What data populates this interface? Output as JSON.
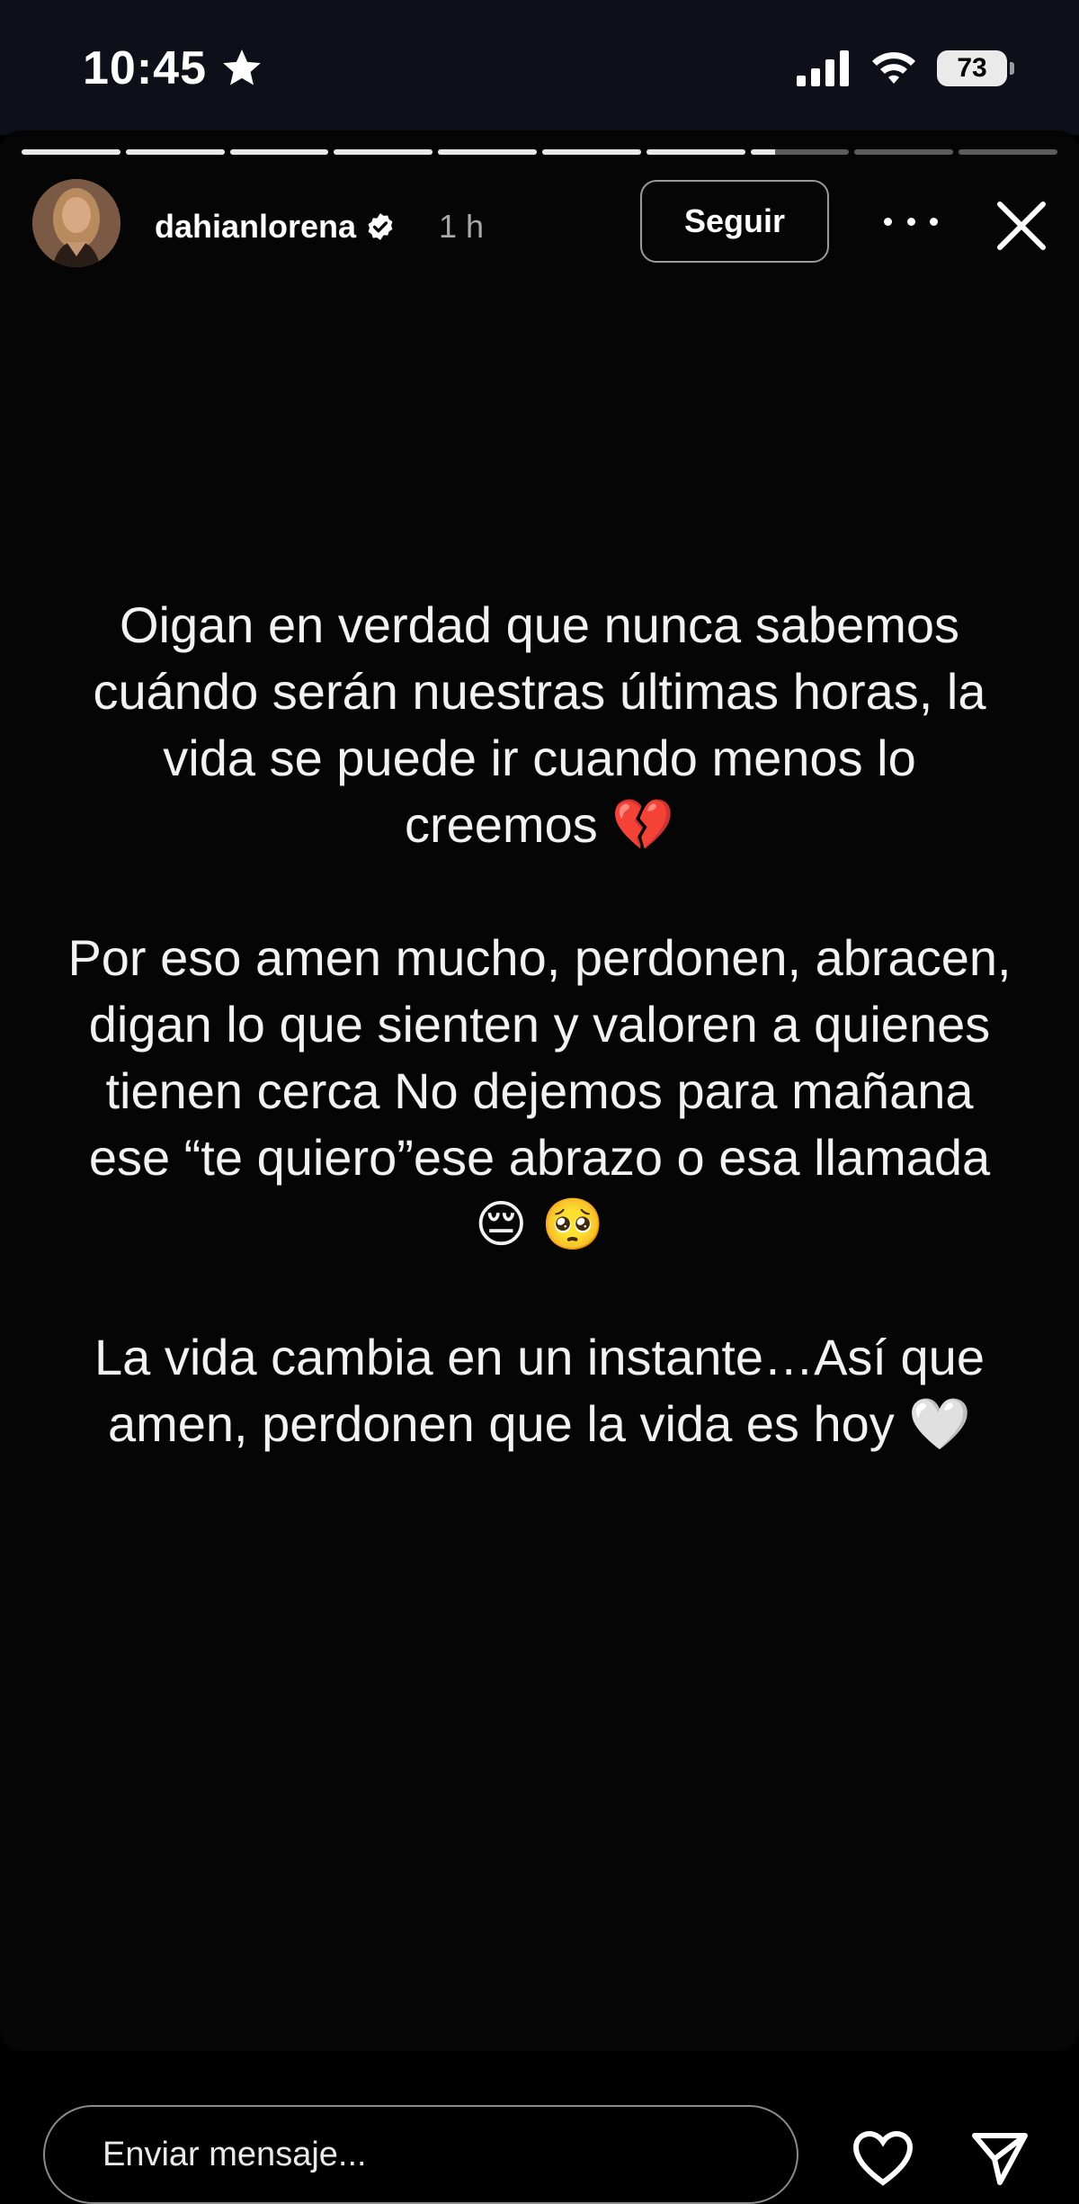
{
  "status_bar": {
    "time": "10:45",
    "battery": "73",
    "icons": [
      "star-icon",
      "signal-icon",
      "wifi-icon",
      "battery-icon"
    ]
  },
  "story": {
    "progress": {
      "segments": 10,
      "current": 8,
      "current_fill": 0.25
    },
    "username": "dahianlorena",
    "time_ago": "1 h",
    "follow_label": "Seguir",
    "paragraphs": [
      "Oigan en verdad que nunca sabemos cuándo serán nuestras últimas horas, la vida se puede ir cuando menos lo creemos 💔",
      "Por eso amen mucho, perdonen, abracen, digan lo que sienten y valoren a quienes tienen cerca No dejemos para mañana ese “te quiero”ese abrazo o esa llamada 😔 🥺",
      "La vida cambia en un instante…Así que amen, perdonen que la vida es hoy 🤍"
    ]
  },
  "reply_bar": {
    "placeholder": "Enviar mensaje..."
  },
  "colors": {
    "background": "#000000",
    "status_bar_bg": "#0d1019",
    "text": "#ffffff",
    "muted_text": "#a8a8a8"
  }
}
